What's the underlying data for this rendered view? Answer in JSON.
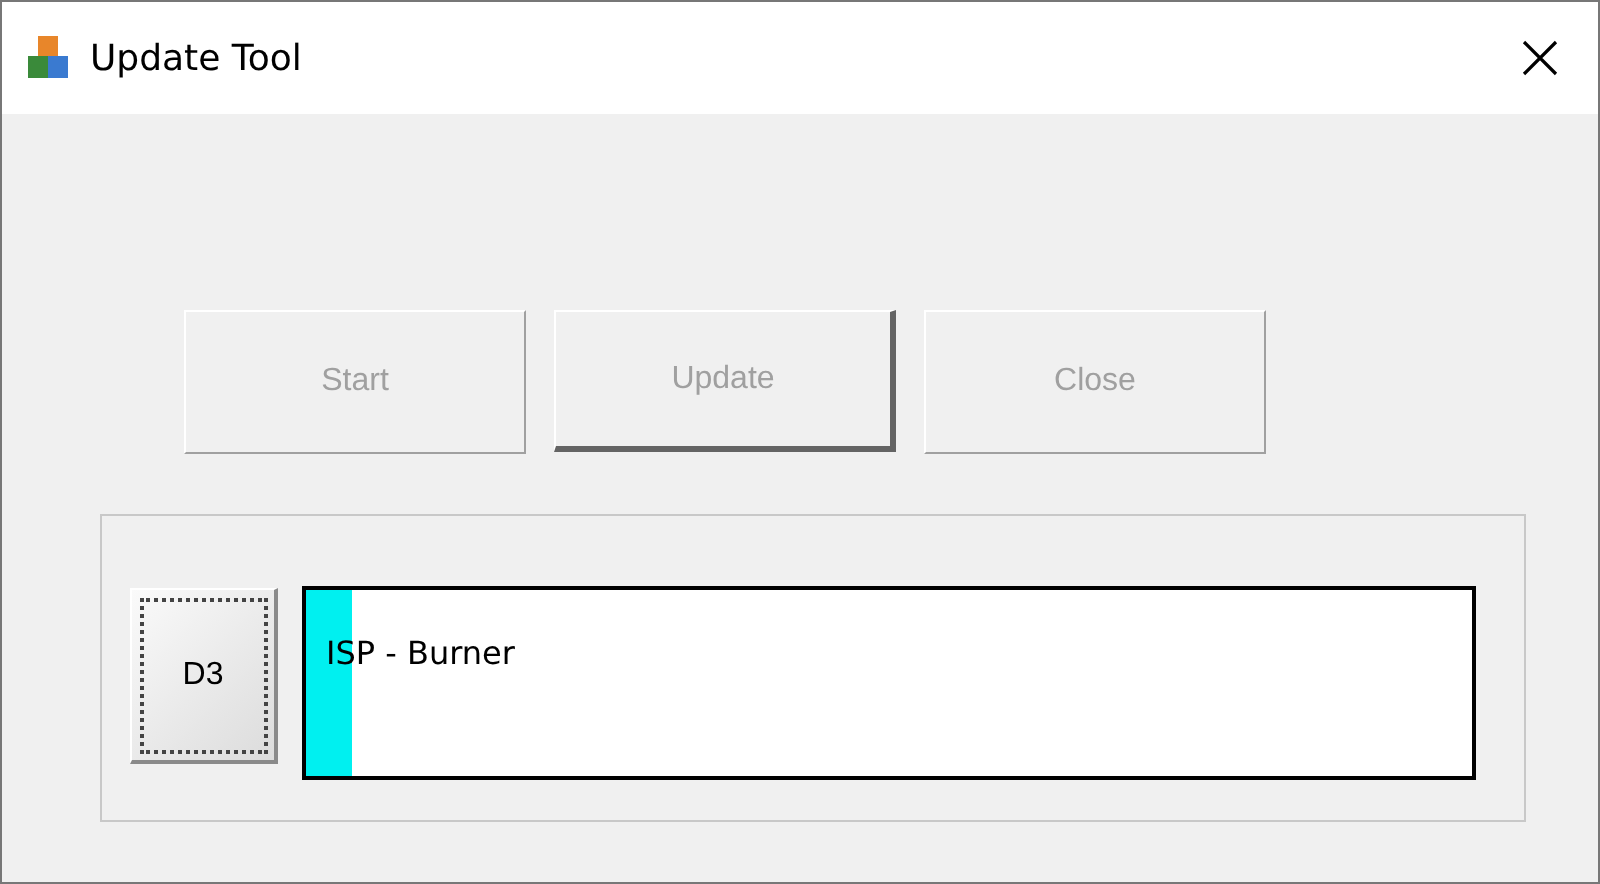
{
  "window": {
    "title": "Update Tool"
  },
  "buttons": [
    {
      "label": "Start",
      "disabled": true,
      "default": false
    },
    {
      "label": "Update",
      "disabled": true,
      "default": true
    },
    {
      "label": "Close",
      "disabled": true,
      "default": false
    }
  ],
  "device": {
    "button": {
      "label": "D3",
      "focused": true
    },
    "progress": {
      "label": "ISP - Burner",
      "level": 0.04
    }
  }
}
